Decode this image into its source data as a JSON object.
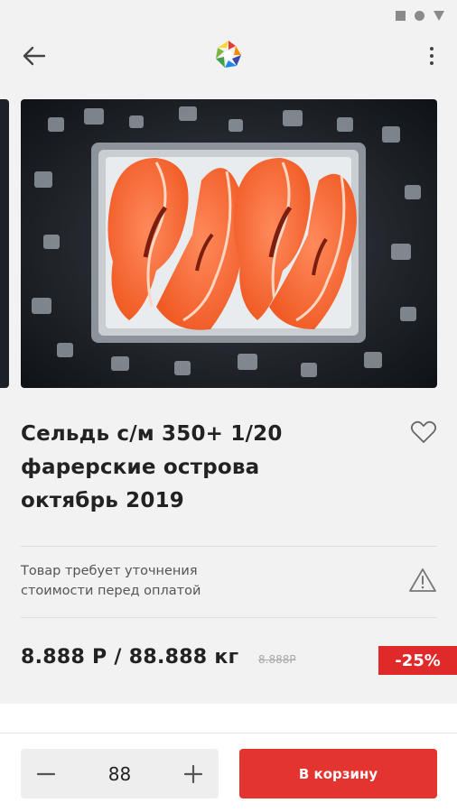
{
  "product": {
    "title_line1": "Сельдь с/м 350+ 1/20",
    "title_line2": "фарерские острова",
    "title_line3": "октябрь 2019",
    "notice_line1": "Товар требует уточнения",
    "notice_line2": "стоимости перед оплатой",
    "price": "8.888 Р / 88.888 кг",
    "old_price": "8.888Р",
    "discount": "-25%"
  },
  "cart": {
    "quantity": "88",
    "add_label": "В корзину"
  },
  "icons": {
    "back": "arrow-left-icon",
    "menu": "more-vertical-icon",
    "favorite": "heart-outline-icon",
    "warning": "warning-triangle-icon",
    "minus": "minus-icon",
    "plus": "plus-icon"
  },
  "colors": {
    "accent": "#e3342f",
    "discount": "#e02929"
  }
}
